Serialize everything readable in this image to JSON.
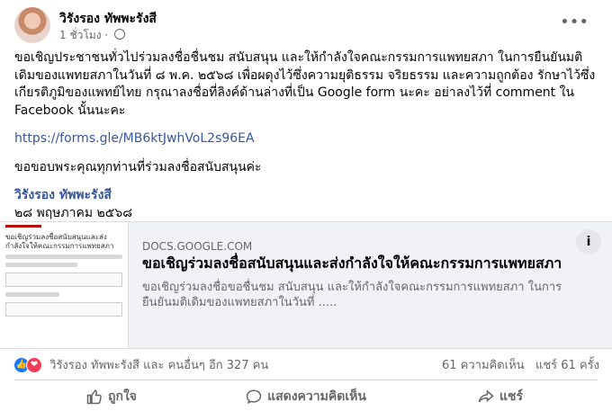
{
  "post": {
    "author": "วิรังรอง ทัพพะรังสี",
    "time": "1 ชั่วโมง",
    "dot": "·",
    "body": "ขอเชิญประชาชนทั่วไปร่วมลงชื่อชื่นชม สนับสนุน และให้กำลังใจคณะกรรมการแพทยสภา ในการยืนยันมติเดิมของแพทยสภาในวันที่ ๘ พ.ค. ๒๕๖๘ เพื่อผดุงไว้ซึ่งความยุติธรรม จริยธรรม และความถูกต้อง รักษาไว้ซึ่งเกียรติภูมิของแพทย์ไทย กรุณาลงชื่อที่ลิงค์ด้านล่างที่เป็น Google form นะคะ อย่าลงไว้ที่ comment ใน Facebook นั้นนะคะ",
    "link": "https://forms.gle/MB6ktJwhVoL2s96EA",
    "thanks": "ขอขอบพระคุณทุกท่านที่ร่วมลงชื่อสนับสนุนค่ะ",
    "signature": "วิรังรอง ทัพพะรังสี",
    "date": "๒๘ พฤษภาคม ๒๕๖๘"
  },
  "preview": {
    "domain": "DOCS.GOOGLE.COM",
    "title": "ขอเชิญร่วมลงชื่อสนับสนุนและส่งกำลังใจให้คณะกรรมการแพทยสภา",
    "description": "ขอเชิญร่วมลงชื่อขอชื่นชม สนับสนุน และให้กำลังใจคณะกรรมการแพทยสภา ในการยืนยันมติเดิมของแพทยสภาในวันที่ .....",
    "info": "i",
    "thumb_title": "ขอเชิญร่วมลงชื่อสนับสนุนและส่งกำลังใจให้คณะกรรมการแพทยสภา"
  },
  "stats": {
    "reactions": "วิรังรอง ทัพพะรังสี และ คนอื่นๆ อีก 327 คน",
    "comments": "61 ความคิดเห็น",
    "shares": "แชร์ 61 ครั้ง"
  },
  "actions": {
    "like": "ถูกใจ",
    "comment": "แสดงความคิดเห็น",
    "share": "แชร์"
  },
  "icons": {
    "more": "more-options-icon",
    "globe": "globe-icon",
    "like_reaction": "like-reaction-icon",
    "love_reaction": "love-reaction-icon"
  },
  "colors": {
    "link": "#385898",
    "brand": "#1877f2",
    "love": "#f33e58"
  }
}
